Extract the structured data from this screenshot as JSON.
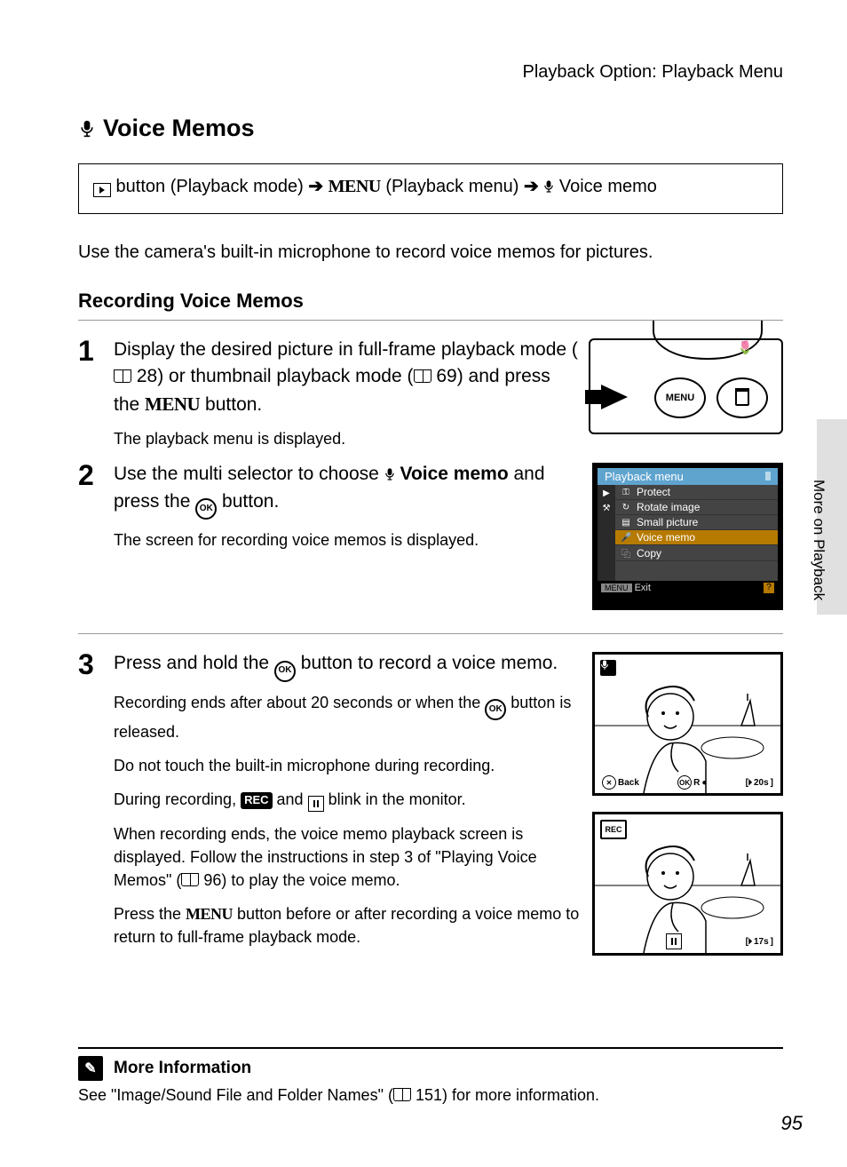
{
  "header": {
    "breadcrumb": "Playback Option: Playback Menu"
  },
  "title": "Voice Memos",
  "nav_path": {
    "step1": " button (Playback mode) ",
    "step2": " (Playback menu) ",
    "step3": " Voice memo"
  },
  "intro": "Use the camera's built-in microphone to record voice memos for pictures.",
  "sub_heading": "Recording Voice Memos",
  "steps": {
    "s1": {
      "num": "1",
      "main_a": "Display the desired picture in full-frame playback mode (",
      "ref1": " 28) or thumbnail playback mode (",
      "ref2": " 69) and press the ",
      "main_b": " button.",
      "note": "The playback menu is displayed."
    },
    "s2": {
      "num": "2",
      "main_a": "Use the multi selector to choose ",
      "bold1": "Voice memo",
      "main_b": " and press the ",
      "main_c": " button.",
      "note": "The screen for recording voice memos is displayed."
    },
    "s3": {
      "num": "3",
      "main_a": "Press and hold the ",
      "main_b": " button to record a voice memo.",
      "note1a": "Recording ends after about 20 seconds or when the ",
      "note1b": " button is released.",
      "note2": "Do not touch the built-in microphone during recording.",
      "note3a": "During recording, ",
      "note3b": " and ",
      "note3c": " blink in the monitor.",
      "note4a": "When recording ends, the voice memo playback screen is displayed. Follow the instructions in step 3 of \"Playing Voice Memos\" (",
      "note4b": " 96) to play the voice memo.",
      "note5a": "Press the ",
      "note5b": " button before or after recording a voice memo to return to full-frame playback mode."
    }
  },
  "cam_labels": {
    "menu": "MENU"
  },
  "lcd": {
    "title": "Playback menu",
    "items": [
      "Protect",
      "Rotate image",
      "Small picture",
      "Voice memo",
      "Copy"
    ],
    "exit": "Exit"
  },
  "photo1": {
    "back": "Back",
    "rec": "R",
    "time": "20s"
  },
  "photo2": {
    "rec_badge": "REC",
    "time": "17s"
  },
  "side_tab": "More on Playback",
  "more_info": {
    "heading": "More Information",
    "text_a": "See \"Image/Sound File and Folder Names\" (",
    "text_b": " 151) for more information."
  },
  "page_number": "95",
  "menu_word": "MENU",
  "ok_label": "OK",
  "rec_label": "REC"
}
